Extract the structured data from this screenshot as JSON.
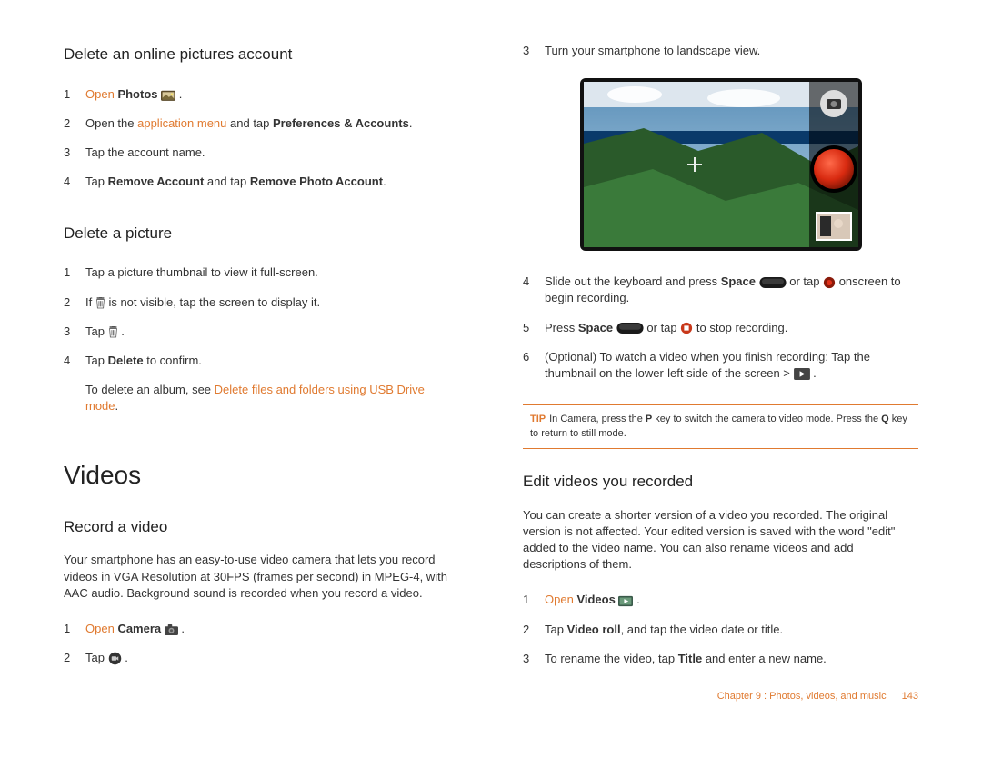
{
  "left": {
    "h_delete_account": "Delete an online pictures account",
    "da": {
      "n1": "1",
      "s1a": "Open",
      "s1b": "Photos",
      "n2": "2",
      "s2a": "Open the ",
      "s2link": "application menu",
      "s2b": " and tap ",
      "s2c": "Preferences & Accounts",
      "n3": "3",
      "s3": "Tap the account name.",
      "n4": "4",
      "s4a": "Tap ",
      "s4b": "Remove Account",
      "s4c": " and tap ",
      "s4d": "Remove Photo Account"
    },
    "h_delete_picture": "Delete a picture",
    "dp": {
      "n1": "1",
      "s1": "Tap a picture thumbnail to view it full-screen.",
      "n2": "2",
      "s2a": "If ",
      "s2b": " is not visible, tap the screen to display it.",
      "n3": "3",
      "s3": "Tap ",
      "n4": "4",
      "s4a": "Tap ",
      "s4b": "Delete",
      "s4c": " to confirm.",
      "note_a": "To delete an album, see ",
      "note_link": "Delete files and folders using USB Drive mode"
    },
    "h_videos": "Videos",
    "h_record": "Record a video",
    "rec_intro": "Your smartphone has an easy-to-use video camera that lets you record videos in VGA Resolution at 30FPS (frames per second) in MPEG-4, with AAC audio. Background sound is recorded when you record a video.",
    "rv": {
      "n1": "1",
      "s1a": "Open",
      "s1b": "Camera",
      "n2": "2",
      "s2": "Tap "
    }
  },
  "right": {
    "land": {
      "n": "3",
      "t": "Turn your smartphone to landscape view."
    },
    "r4": {
      "n": "4",
      "a": "Slide out the keyboard and press ",
      "b": "Space",
      "c": " or tap ",
      "d": " onscreen to begin recording."
    },
    "r5": {
      "n": "5",
      "a": "Press ",
      "b": "Space",
      "c": " or tap ",
      "d": " to stop recording."
    },
    "r6": {
      "n": "6",
      "a": "(Optional) To watch a video when you finish recording: Tap the thumbnail on the lower-left side of the screen > "
    },
    "tip": {
      "label": "TIP",
      "a": "In Camera, press the ",
      "b": "P",
      "c": " key to switch the camera to video mode. Press the ",
      "d": "Q",
      "e": " key to return to still mode."
    },
    "h_edit": "Edit videos you recorded",
    "edit_intro": "You can create a shorter version of a video you recorded. The original version is not affected. Your edited version is saved with the word \"edit\" added to the video name. You can also rename videos and add descriptions of them.",
    "ev": {
      "n1": "1",
      "s1a": "Open",
      "s1b": "Videos",
      "n2": "2",
      "s2a": "Tap ",
      "s2b": "Video roll",
      "s2c": ", and tap the video date or title.",
      "n3": "3",
      "s3a": "To rename the video, tap ",
      "s3b": "Title",
      "s3c": " and enter a new name."
    }
  },
  "footer": {
    "chapter": "Chapter 9 : Photos, videos, and music",
    "page": "143"
  }
}
